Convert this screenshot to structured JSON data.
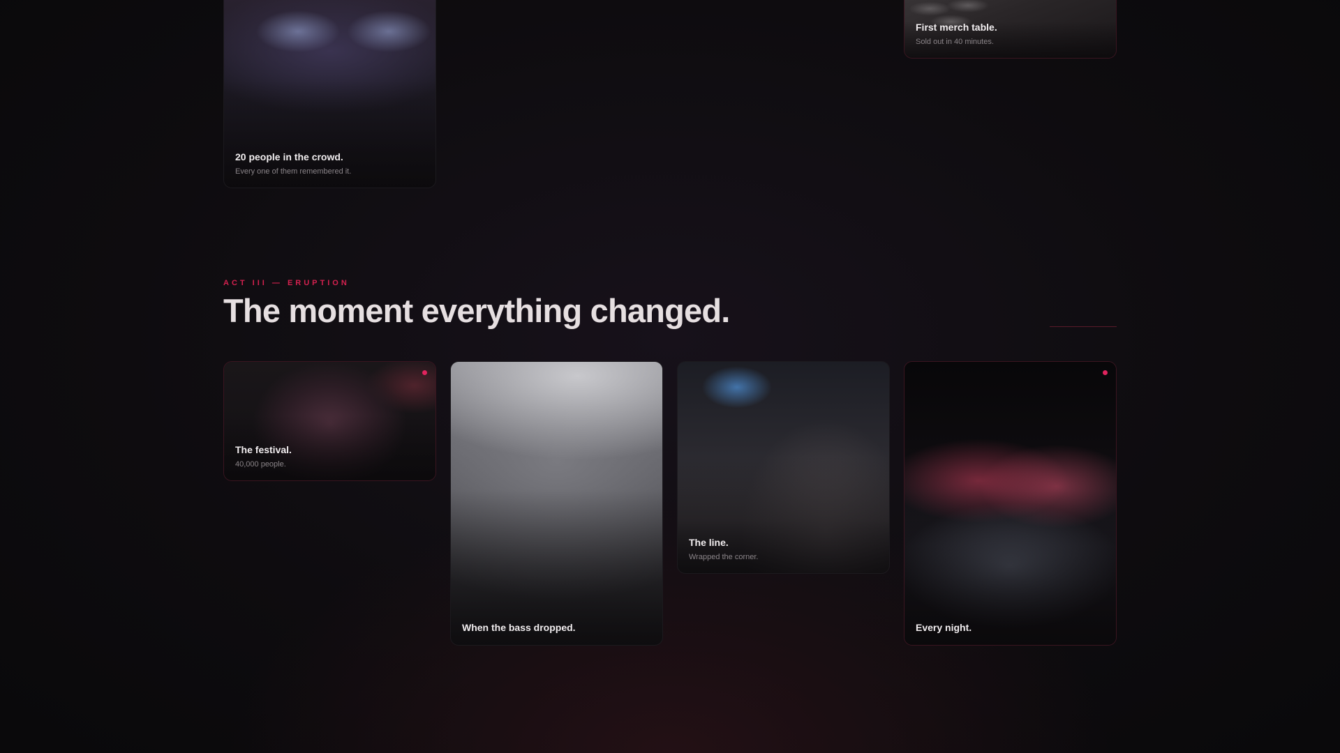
{
  "accent_color": "#e0245e",
  "top_row": {
    "cards": [
      {
        "id": "crowd",
        "title": "20 people in the crowd.",
        "subtitle": "Every one of them remembered it."
      },
      {
        "id": "merch",
        "title": "First merch table.",
        "subtitle": "Sold out in 40 minutes."
      }
    ]
  },
  "section": {
    "label": "ACT III — ERUPTION",
    "title": "The moment everything changed."
  },
  "gallery": {
    "cards": [
      {
        "id": "festival",
        "title": "The festival.",
        "subtitle": "40,000 people.",
        "highlighted": true
      },
      {
        "id": "bass",
        "title": "When the bass dropped.",
        "subtitle": "",
        "highlighted": false
      },
      {
        "id": "line",
        "title": "The line.",
        "subtitle": "Wrapped the corner.",
        "highlighted": false
      },
      {
        "id": "night",
        "title": "Every night.",
        "subtitle": "",
        "highlighted": true
      }
    ]
  }
}
